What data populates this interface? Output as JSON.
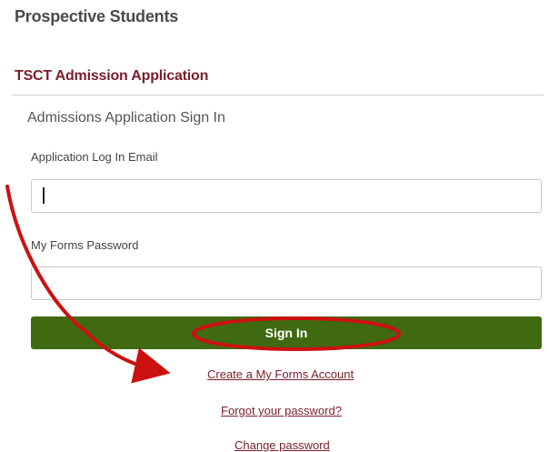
{
  "page": {
    "heading": "Prospective Students"
  },
  "application": {
    "title": "TSCT Admission Application"
  },
  "signin_form": {
    "title": "Admissions Application Sign In",
    "email_label": "Application Log In Email",
    "email_value": "",
    "password_label": "My Forms Password",
    "password_value": "",
    "submit_label": "Sign In"
  },
  "links": {
    "create_account": "Create a My Forms Account",
    "forgot_password": "Forgot your password?",
    "change_password": "Change password"
  },
  "colors": {
    "accent": "#7a1e2c",
    "button": "#3f6a12",
    "annotation": "#cc1111"
  }
}
